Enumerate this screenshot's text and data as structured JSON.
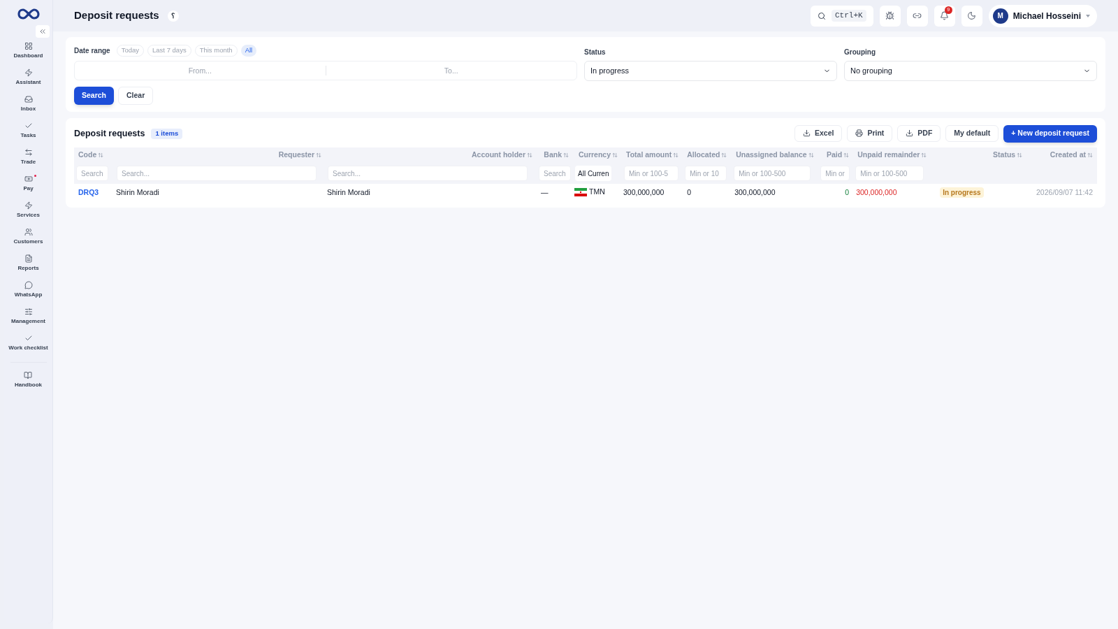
{
  "header": {
    "title": "Deposit requests",
    "help": "؟",
    "search_shortcut": "Ctrl+K",
    "notifications": "9",
    "user": {
      "initial": "M",
      "name": "Michael Hosseini"
    }
  },
  "sidebar": {
    "items": [
      {
        "label": "Dashboard",
        "badge": false
      },
      {
        "label": "Assistant",
        "badge": false
      },
      {
        "label": "Inbox",
        "badge": false
      },
      {
        "label": "Tasks",
        "badge": false
      },
      {
        "label": "Trade",
        "badge": false
      },
      {
        "label": "Pay",
        "badge": true
      },
      {
        "label": "Services",
        "badge": false
      },
      {
        "label": "Customers",
        "badge": false
      },
      {
        "label": "Reports",
        "badge": false
      },
      {
        "label": "WhatsApp",
        "badge": false
      },
      {
        "label": "Management",
        "badge": false
      },
      {
        "label": "Work checklist",
        "badge": false
      }
    ],
    "footer_item": {
      "label": "Handbook"
    }
  },
  "filters": {
    "date_range": {
      "label": "Date range",
      "presets": [
        {
          "label": "Today",
          "selected": false
        },
        {
          "label": "Last 7 days",
          "selected": false
        },
        {
          "label": "This month",
          "selected": false
        },
        {
          "label": "All",
          "selected": true
        }
      ],
      "from_placeholder": "From...",
      "to_placeholder": "To..."
    },
    "status": {
      "label": "Status",
      "value": "In progress"
    },
    "grouping": {
      "label": "Grouping",
      "value": "No grouping"
    },
    "buttons": [
      "Search",
      "Clear"
    ]
  },
  "table": {
    "title": "Deposit requests",
    "count": "1 items",
    "actions": [
      "Excel",
      "Print",
      "PDF",
      "My default"
    ],
    "primary_action": "+ New deposit request",
    "columns": [
      {
        "label": "Code",
        "placeholder": "Search"
      },
      {
        "label": "Requester",
        "placeholder": "Search..."
      },
      {
        "label": "Account holder",
        "placeholder": "Search..."
      },
      {
        "label": "Bank",
        "placeholder": "Search"
      },
      {
        "label": "Currency",
        "filter_value": "All Curren"
      },
      {
        "label": "Total amount",
        "placeholder": "Min or 100-5"
      },
      {
        "label": "Allocated",
        "placeholder": "Min or 10"
      },
      {
        "label": "Unassigned balance",
        "placeholder": "Min or 100-500"
      },
      {
        "label": "Paid",
        "placeholder": "Min or"
      },
      {
        "label": "Unpaid remainder",
        "placeholder": "Min or 100-500"
      },
      {
        "label": "Status"
      },
      {
        "label": "Created at"
      }
    ],
    "rows": [
      {
        "code": "DRQ3",
        "requester": "Shirin Moradi",
        "account_holder": "Shirin Moradi",
        "bank": "—",
        "currency": "TMN",
        "total_amount": "300,000,000",
        "allocated": "0",
        "unassigned_balance": "300,000,000",
        "paid": "0",
        "unpaid_remainder": "300,000,000",
        "status": {
          "text": "In progress",
          "kind": "in_progress"
        },
        "created_at": "2026/09/07 11:42"
      }
    ]
  }
}
